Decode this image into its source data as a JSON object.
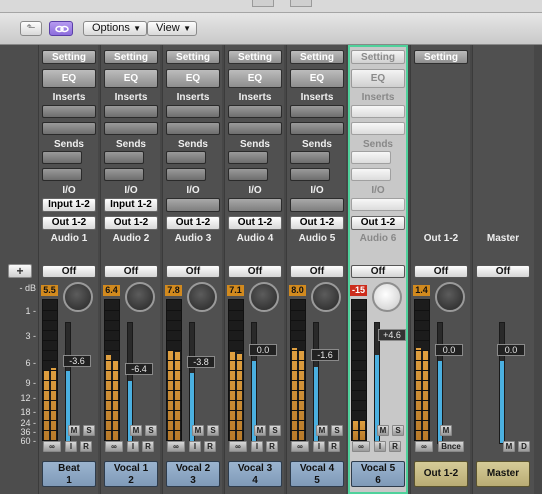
{
  "toolbar": {
    "back_glyph": "⬑",
    "options_label": "Options",
    "view_label": "View",
    "menu_arrow": "▼",
    "link_icon": "link-icon"
  },
  "scale": {
    "add_label": "+",
    "ticks": [
      "- dB",
      "1 -",
      "3 -",
      "6 -",
      "9 -",
      "12 -",
      "18 -",
      "24 -",
      "36 -",
      "60 -"
    ]
  },
  "labels": {
    "setting": "Setting",
    "eq": "EQ",
    "inserts": "Inserts",
    "sends": "Sends",
    "io": "I/O",
    "off": "Off",
    "mute": "M",
    "solo": "S",
    "input": "I",
    "record": "R",
    "bounce": "Bnce",
    "dim": "D"
  },
  "strips": [
    {
      "io_in": "Input 1-2",
      "io_out": "Out 1-2",
      "name": "Audio 1",
      "peak": "5.5",
      "fader": "-3.6",
      "track1": "Beat",
      "track2": "1"
    },
    {
      "io_in": "Input 1-2",
      "io_out": "Out 1-2",
      "name": "Audio 2",
      "peak": "6.4",
      "fader": "-6.4",
      "track1": "Vocal 1",
      "track2": "2"
    },
    {
      "io_in": "",
      "io_out": "Out 1-2",
      "name": "Audio 3",
      "peak": "7.8",
      "fader": "-3.8",
      "track1": "Vocal 2",
      "track2": "3"
    },
    {
      "io_in": "",
      "io_out": "Out 1-2",
      "name": "Audio 4",
      "peak": "7.1",
      "fader": "0.0",
      "track1": "Vocal 3",
      "track2": "4"
    },
    {
      "io_in": "",
      "io_out": "Out 1-2",
      "name": "Audio 5",
      "peak": "8.0",
      "fader": "-1.6",
      "track1": "Vocal 4",
      "track2": "5"
    },
    {
      "io_in": "",
      "io_out": "Out 1-2",
      "name": "Audio 6",
      "peak": "-15",
      "fader": "+4.6",
      "track1": "Vocal 5",
      "track2": "6"
    }
  ],
  "aux": {
    "io_label": "Out 1-2",
    "peak": "1.4",
    "fader": "0.0",
    "track1": "Out 1-2"
  },
  "master": {
    "name": "Master",
    "fader": "0.0",
    "track1": "Master"
  }
}
